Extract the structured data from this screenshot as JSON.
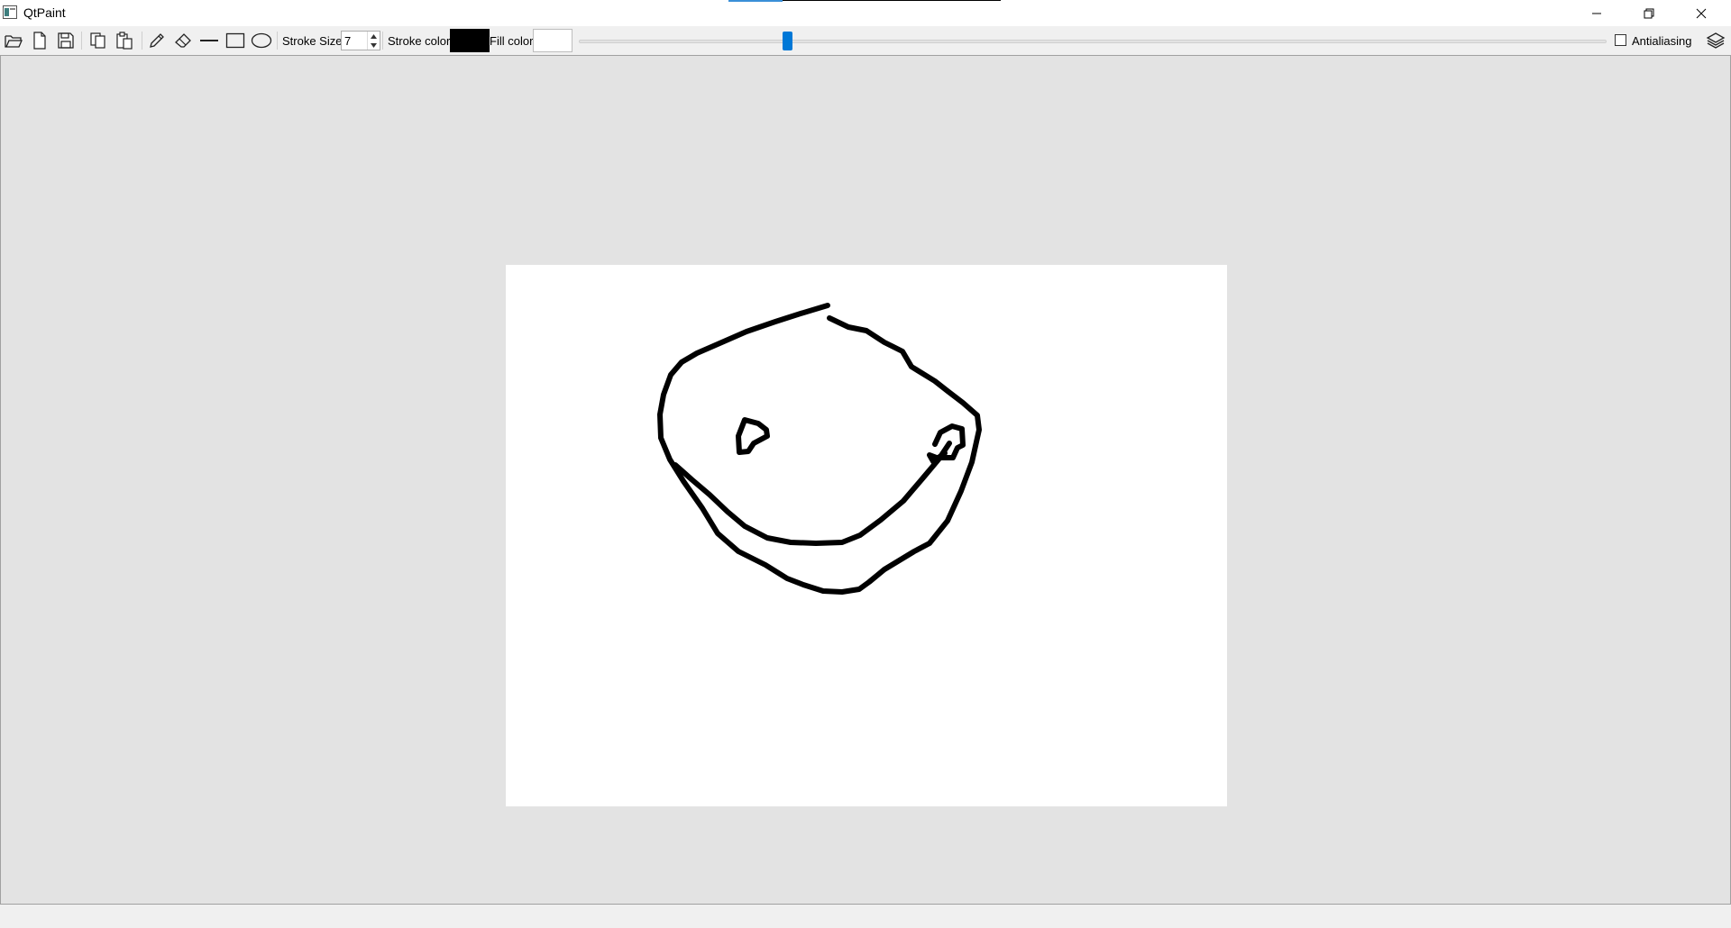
{
  "window": {
    "title": "QtPaint",
    "controls": {
      "minimize": "minimize-icon",
      "restore": "restore-icon",
      "close": "close-icon"
    }
  },
  "toolbar": {
    "file_tools": [
      "open-icon",
      "new-icon",
      "save-icon"
    ],
    "edit_tools": [
      "copy-icon",
      "paste-icon"
    ],
    "draw_tools": [
      "pencil-icon",
      "eraser-icon",
      "line-icon",
      "rectangle-icon",
      "ellipse-icon"
    ],
    "stroke_size_label": "Stroke Size",
    "stroke_size_value": "7",
    "stroke_color_label": "Stroke color",
    "stroke_color": "#000000",
    "fill_color_label": "Fill color",
    "fill_color": "#ffffff",
    "slider_value_fraction": 0.2,
    "antialiasing_label": "Antialiasing",
    "antialiasing_checked": false,
    "layers_icon": "layers-icon"
  },
  "canvas": {
    "background": "#ffffff",
    "drawing": "smiley-face"
  },
  "colors": {
    "workspace": "#e3e3e3",
    "accent": "#0078d7"
  }
}
